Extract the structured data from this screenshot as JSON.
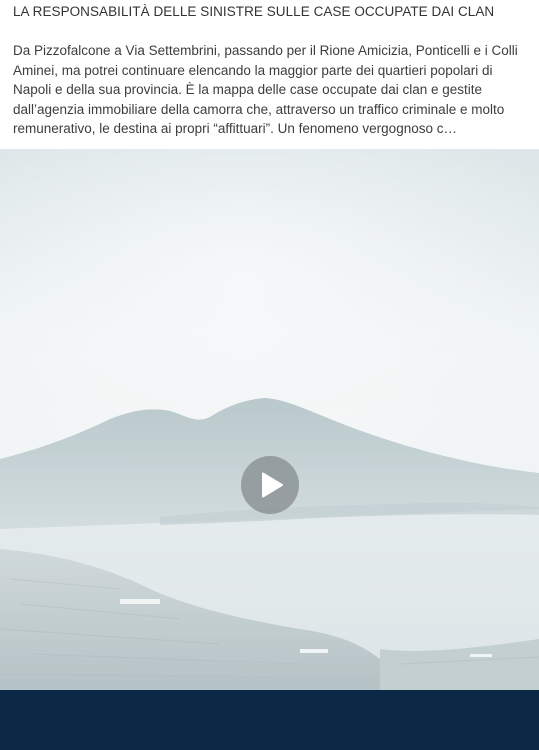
{
  "post": {
    "title": "LA RESPONSABILITÀ DELLE SINISTRE SULLE CASE OCCUPATE DAI CLAN",
    "excerpt": "Da Pizzofalcone a Via Settembrini, passando per il Rione Amicizia, Ponticelli e i Colli Aminei, ma potrei continuare elencando la maggior parte dei quartieri popolari di Napoli e della sua provincia. È la mappa delle case occupate dai clan e gestite dall’agenzia immobiliare della camorra che, attraverso un traffico criminale e molto remunerativo, le destina ai propri “affittuari”. Un fenomeno vergognoso c…"
  },
  "video": {
    "thumbnail": "vesuvius-bay-of-naples-icon",
    "play_icon": "play-icon"
  },
  "colors": {
    "bottom_bar": "#0b2847",
    "play_button": "#8c9496",
    "sky": "#e4eced",
    "mountain": "#c3d0d3"
  }
}
